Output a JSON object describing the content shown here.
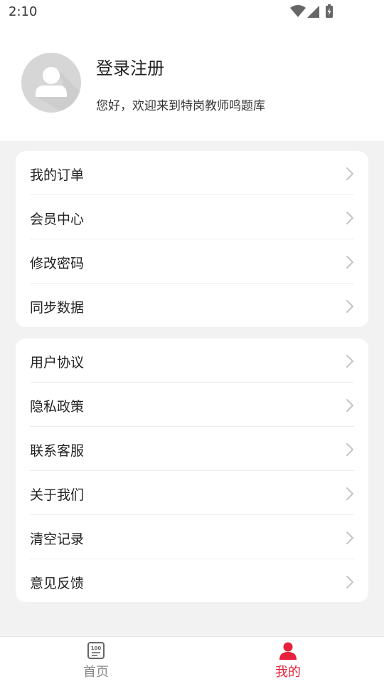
{
  "status_bar": {
    "time": "2:10"
  },
  "profile": {
    "title": "登录注册",
    "subtitle": "您好，欢迎来到特岗教师鸣题库"
  },
  "menu_group_1": [
    {
      "label": "我的订单"
    },
    {
      "label": "会员中心"
    },
    {
      "label": "修改密码"
    },
    {
      "label": "同步数据"
    }
  ],
  "menu_group_2": [
    {
      "label": "用户协议"
    },
    {
      "label": "隐私政策"
    },
    {
      "label": "联系客服"
    },
    {
      "label": "关于我们"
    },
    {
      "label": "清空记录"
    },
    {
      "label": "意见反馈"
    }
  ],
  "bottom_nav": {
    "home_label": "首页",
    "mine_label": "我的",
    "home_icon": "exam-book-icon",
    "mine_icon": "person-icon"
  },
  "colors": {
    "accent": "#e8203b",
    "background": "#f2f2f2",
    "card": "#ffffff"
  }
}
